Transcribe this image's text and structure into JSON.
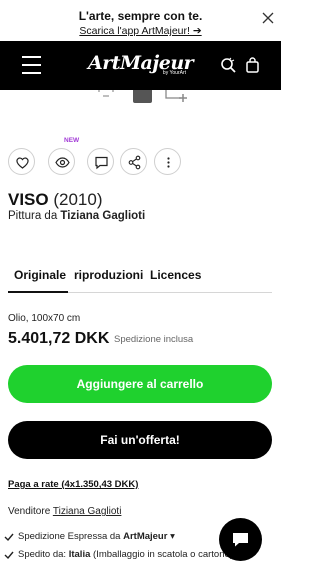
{
  "promo": {
    "title": "L'arte, sempre con te.",
    "link": "Scarica l'app ArtMajeur! ➔"
  },
  "header": {
    "logo": "ArtMajeur",
    "logo_sub": "by YourArt"
  },
  "actions": {
    "new_badge": "NEW"
  },
  "artwork": {
    "title": "VISO",
    "year": "(2010)",
    "sub_prefix": "Pittura da ",
    "artist": "Tiziana Gaglioti"
  },
  "tabs": [
    "Originale",
    "riproduzioni",
    "Licences"
  ],
  "offer": {
    "specs": "Olio, 100x70 cm",
    "price": "5.401,72 DKK",
    "shipping": "Spedizione inclusa",
    "cart_button": "Aggiungere al carrello",
    "offer_button": "Fai un'offerta!",
    "installment": "Paga a rate (4x1.350,43 DKK)",
    "seller_label": "Venditore ",
    "seller_name": "Tiziana Gaglioti"
  },
  "shipping_lines": [
    {
      "prefix": "Spedizione Espressa da ",
      "bold": "ArtMajeur",
      "suffix": " ▾"
    },
    {
      "prefix": "Spedito da: ",
      "bold": "Italia",
      "suffix": " (Imballaggio in scatola o cartone)"
    }
  ],
  "colors": {
    "cart": "#1fd12e",
    "offer": "#000000",
    "new_badge": "#a23ad6"
  }
}
